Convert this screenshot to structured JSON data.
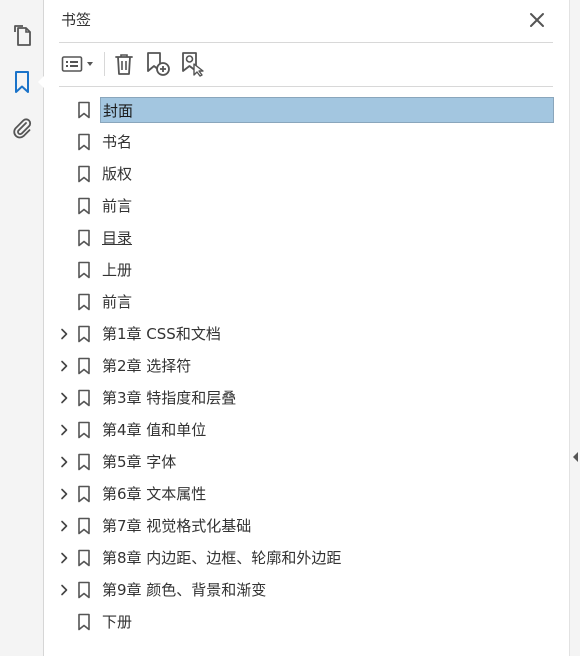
{
  "rail": {
    "items": [
      {
        "name": "page-thumbnails-button",
        "icon": "copy-pages-icon"
      },
      {
        "name": "bookmarks-button",
        "icon": "bookmark-icon",
        "active": true
      },
      {
        "name": "attachments-button",
        "icon": "paperclip-icon"
      }
    ],
    "accent": "#1a73c9"
  },
  "panel": {
    "title": "书签",
    "close_icon": "close-icon"
  },
  "toolbar": {
    "options_icon": "list-options-icon",
    "dropdown_icon": "caret-down-icon",
    "delete_icon": "trash-icon",
    "new_bookmark_icon": "add-bookmark-icon",
    "find_current_icon": "find-bookmark-icon"
  },
  "bookmarks": [
    {
      "label": "封面",
      "expandable": false,
      "selected": true
    },
    {
      "label": "书名",
      "expandable": false
    },
    {
      "label": "版权",
      "expandable": false
    },
    {
      "label": "前言",
      "expandable": false
    },
    {
      "label": "目录",
      "expandable": false,
      "underlined": true
    },
    {
      "label": "上册",
      "expandable": false
    },
    {
      "label": "前言",
      "expandable": false
    },
    {
      "label": "第1章 CSS和文档",
      "expandable": true
    },
    {
      "label": "第2章 选择符",
      "expandable": true
    },
    {
      "label": "第3章 特指度和层叠",
      "expandable": true
    },
    {
      "label": "第4章 值和单位",
      "expandable": true
    },
    {
      "label": "第5章 字体",
      "expandable": true
    },
    {
      "label": "第6章 文本属性",
      "expandable": true
    },
    {
      "label": "第7章 视觉格式化基础",
      "expandable": true
    },
    {
      "label": "第8章 内边距、边框、轮廓和外边距",
      "expandable": true
    },
    {
      "label": "第9章 颜色、背景和渐变",
      "expandable": true
    },
    {
      "label": "下册",
      "expandable": false
    }
  ],
  "colors": {
    "selection": "#a3c6e0",
    "icon": "#555555"
  }
}
